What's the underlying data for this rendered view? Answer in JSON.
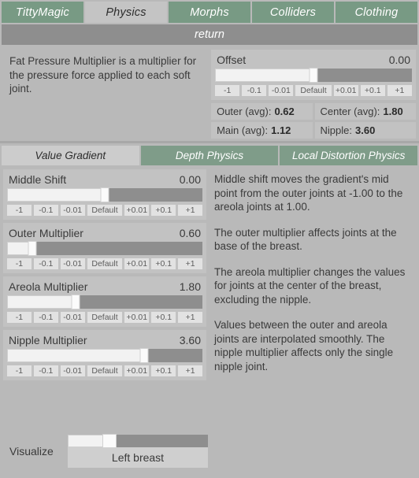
{
  "colors": {
    "tab_green": "#789a84",
    "tab_active": "#c4c4c4",
    "panel_bg": "#b9b9b9",
    "widget_bg": "#c2c2c2",
    "track_bg": "#8e8e8e",
    "fill": "#f2f2f2",
    "return_bar": "#8e8e8e"
  },
  "top_tabs": [
    {
      "label": "TittyMagic",
      "active": false
    },
    {
      "label": "Physics",
      "active": true
    },
    {
      "label": "Morphs",
      "active": false
    },
    {
      "label": "Colliders",
      "active": false
    },
    {
      "label": "Clothing",
      "active": false
    }
  ],
  "return_bar": {
    "label": "return"
  },
  "info": {
    "text": "Fat Pressure Multiplier is a multiplier for the pressure force applied to each soft joint."
  },
  "step_buttons": [
    "-1",
    "-0.1",
    "-0.01",
    "Default",
    "+0.01",
    "+0.1",
    "+1"
  ],
  "offset_slider": {
    "label": "Offset",
    "value": "0.00",
    "fill_percent": 50
  },
  "stats": [
    {
      "label": "Outer (avg):",
      "value": "0.62"
    },
    {
      "label": "Center (avg):",
      "value": "1.80"
    },
    {
      "label": "Main (avg):",
      "value": "1.12"
    },
    {
      "label": "Nipple:",
      "value": "3.60"
    }
  ],
  "sub_tabs": [
    {
      "label": "Value Gradient",
      "active": true
    },
    {
      "label": "Depth Physics",
      "active": false
    },
    {
      "label": "Local Distortion Physics",
      "active": false
    }
  ],
  "gradient_sliders": [
    {
      "label": "Middle Shift",
      "value": "0.00",
      "fill_percent": 50
    },
    {
      "label": "Outer Multiplier",
      "value": "0.60",
      "fill_percent": 13
    },
    {
      "label": "Areola Multiplier",
      "value": "1.80",
      "fill_percent": 35
    },
    {
      "label": "Nipple Multiplier",
      "value": "3.60",
      "fill_percent": 70
    }
  ],
  "gradient_help": [
    "Middle shift moves the gradient's mid point from the outer joints at -1.00 to the areola joints at 1.00.",
    "The outer multiplier affects joints at the base of the breast.",
    "The areola multiplier changes the values for joints at the center of the breast, excluding the nipple.",
    "Values between the outer and areola joints are interpolated smoothly. The nipple multiplier affects only the single nipple joint."
  ],
  "visualize": {
    "label": "Visualize",
    "value": "Left breast",
    "fill_percent": 30
  }
}
